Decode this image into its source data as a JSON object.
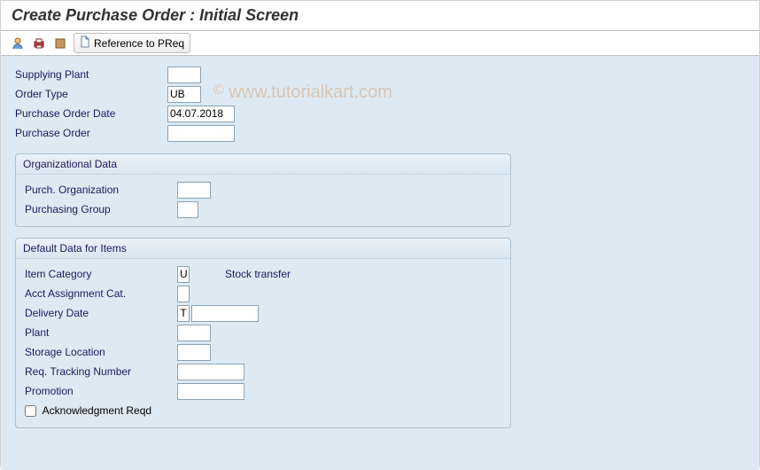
{
  "title": "Create Purchase Order : Initial Screen",
  "toolbar": {
    "ref_label": "Reference to PReq"
  },
  "top_fields": {
    "supplying_plant": {
      "label": "Supplying Plant",
      "value": ""
    },
    "order_type": {
      "label": "Order Type",
      "value": "UB"
    },
    "po_date": {
      "label": "Purchase Order Date",
      "value": "04.07.2018"
    },
    "purchase_order": {
      "label": "Purchase Order",
      "value": ""
    }
  },
  "org": {
    "title": "Organizational Data",
    "purch_org": {
      "label": "Purch. Organization",
      "value": ""
    },
    "purch_group": {
      "label": "Purchasing Group",
      "value": ""
    }
  },
  "defaults": {
    "title": "Default Data for Items",
    "item_category": {
      "label": "Item Category",
      "value": "U",
      "desc": "Stock transfer"
    },
    "acct_cat": {
      "label": "Acct Assignment Cat.",
      "value": ""
    },
    "delivery_date": {
      "label": "Delivery Date",
      "prefix": "T",
      "value": ""
    },
    "plant": {
      "label": "Plant",
      "value": ""
    },
    "storage_loc": {
      "label": "Storage Location",
      "value": ""
    },
    "req_tracking": {
      "label": "Req. Tracking Number",
      "value": ""
    },
    "promotion": {
      "label": "Promotion",
      "value": ""
    },
    "ack_reqd": {
      "label": "Acknowledgment Reqd"
    }
  },
  "watermark": {
    "copy": "©",
    "text": "www.tutorialkart.com"
  }
}
